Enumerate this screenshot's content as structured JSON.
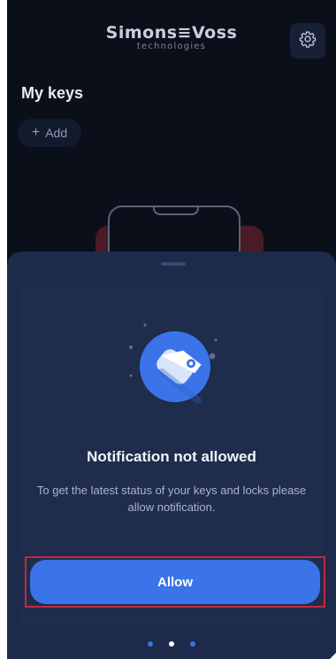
{
  "app": {
    "brand": "Simons≡Voss",
    "brand_sub": "technologies",
    "settings_icon": "gear-icon"
  },
  "home": {
    "section_title": "My keys",
    "add_label": "Add",
    "add_icon": "plus-icon"
  },
  "dialog": {
    "title": "Notification not allowed",
    "message": "To get the latest status of your keys and locks please allow notification.",
    "allow_label": "Allow",
    "illustration_icon": "key-tag-icon",
    "highlight_color": "#c02a3f"
  },
  "pager": {
    "count": 3,
    "active_index": 1
  },
  "colors": {
    "background": "#0b0f1a",
    "sheet": "#1d2a4a",
    "accent": "#3a74e8"
  }
}
